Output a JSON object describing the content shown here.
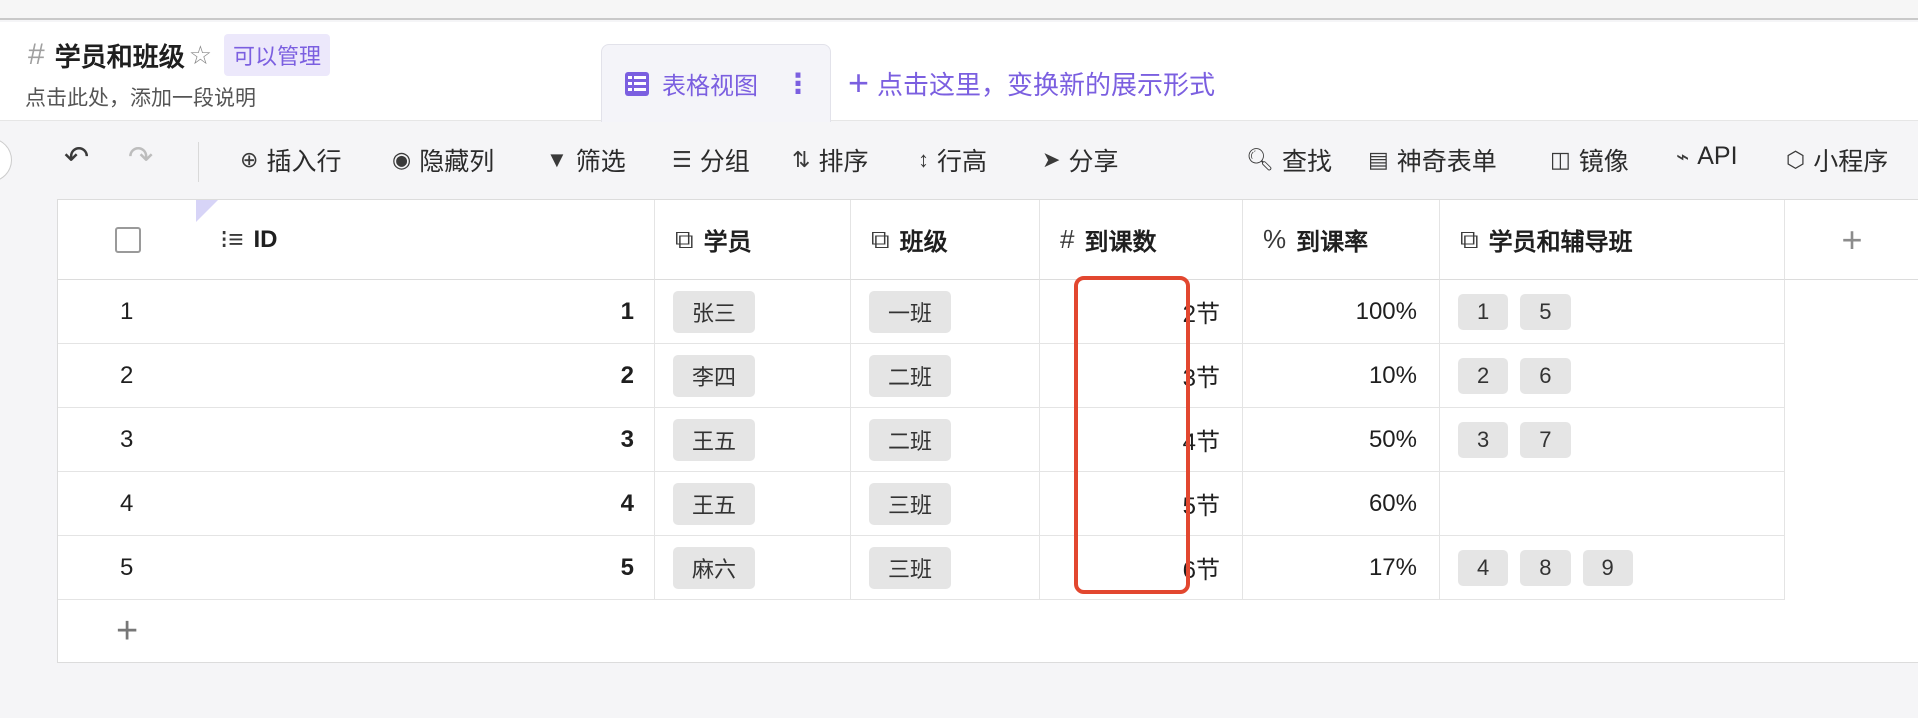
{
  "header": {
    "title": "学员和班级",
    "permission": "可以管理",
    "description": "点击此处，添加一段说明",
    "view_tab": "表格视图",
    "add_view": "点击这里，变换新的展示形式"
  },
  "toolbar": {
    "insert_row": "插入行",
    "hide_column": "隐藏列",
    "filter": "筛选",
    "group": "分组",
    "sort": "排序",
    "row_height": "行高",
    "share": "分享",
    "find": "查找",
    "magic_form": "神奇表单",
    "mirror": "镜像",
    "api": "API",
    "mini_program": "小程序"
  },
  "columns": {
    "id": "ID",
    "student": "学员",
    "class": "班级",
    "attendance_count": "到课数",
    "attendance_rate": "到课率",
    "student_and_tutoring": "学员和辅导班"
  },
  "rows": [
    {
      "index": "1",
      "id": "1",
      "student": "张三",
      "class": "一班",
      "count": "2节",
      "rate": "100%",
      "links": [
        "1",
        "5"
      ]
    },
    {
      "index": "2",
      "id": "2",
      "student": "李四",
      "class": "二班",
      "count": "3节",
      "rate": "10%",
      "links": [
        "2",
        "6"
      ]
    },
    {
      "index": "3",
      "id": "3",
      "student": "王五",
      "class": "二班",
      "count": "4节",
      "rate": "50%",
      "links": [
        "3",
        "7"
      ]
    },
    {
      "index": "4",
      "id": "4",
      "student": "王五",
      "class": "三班",
      "count": "5节",
      "rate": "60%",
      "links": []
    },
    {
      "index": "5",
      "id": "5",
      "student": "麻六",
      "class": "三班",
      "count": "6节",
      "rate": "17%",
      "links": [
        "4",
        "8",
        "9"
      ]
    }
  ],
  "colors": {
    "accent": "#7b5fe0",
    "highlight": "#e2472f"
  }
}
